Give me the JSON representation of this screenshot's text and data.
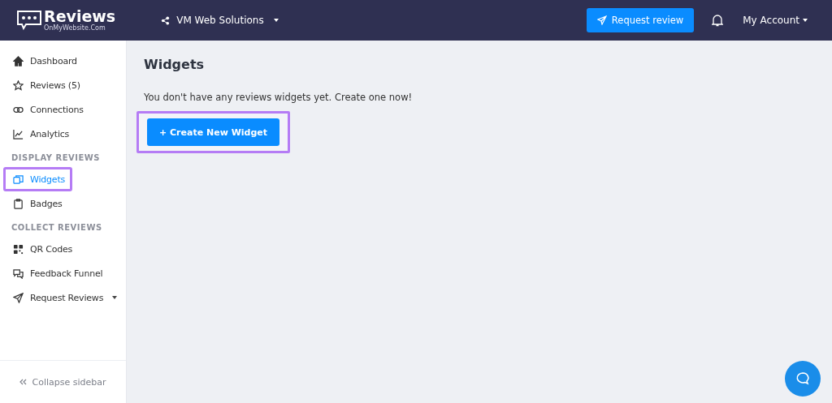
{
  "header": {
    "logo": {
      "title": "Reviews",
      "subtitle": "OnMyWebsite.Com"
    },
    "workspace": "VM Web Solutions",
    "request_button": "Request review",
    "account": "My Account"
  },
  "sidebar": {
    "items": [
      {
        "kind": "item",
        "label": "Dashboard",
        "selected": false,
        "highlighted": false
      },
      {
        "kind": "item",
        "label": "Reviews (5)",
        "selected": false,
        "highlighted": false
      },
      {
        "kind": "item",
        "label": "Connections",
        "selected": false,
        "highlighted": false
      },
      {
        "kind": "item",
        "label": "Analytics",
        "selected": false,
        "highlighted": false
      },
      {
        "kind": "section",
        "label": "DISPLAY REVIEWS"
      },
      {
        "kind": "item",
        "label": "Widgets",
        "selected": true,
        "highlighted": true
      },
      {
        "kind": "item",
        "label": "Badges",
        "selected": false,
        "highlighted": false
      },
      {
        "kind": "section",
        "label": "COLLECT REVIEWS"
      },
      {
        "kind": "item",
        "label": "QR Codes",
        "selected": false,
        "highlighted": false
      },
      {
        "kind": "item",
        "label": "Feedback Funnel",
        "selected": false,
        "highlighted": false
      },
      {
        "kind": "dropdown",
        "label": "Request Reviews",
        "selected": false,
        "highlighted": false
      }
    ],
    "collapse": "Collapse sidebar"
  },
  "main": {
    "title": "Widgets",
    "message": "You don't have any reviews widgets yet. Create one now!",
    "create_button": {
      "label": "+ Create New Widget",
      "highlighted": true
    }
  }
}
